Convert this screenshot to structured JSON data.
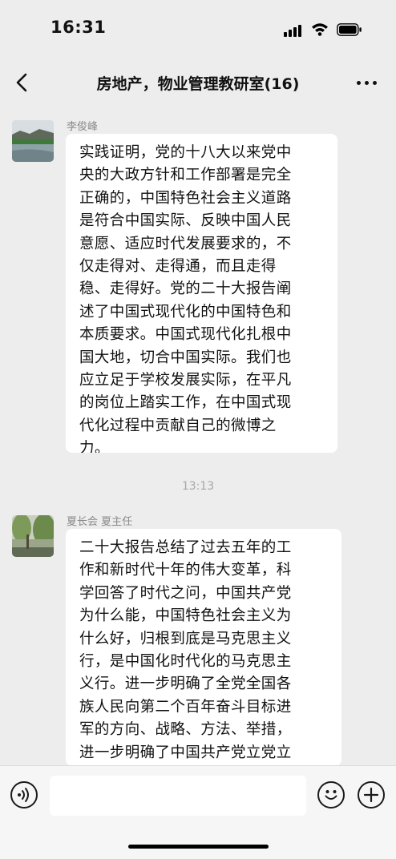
{
  "status_bar": {
    "time": "16:31",
    "icons": [
      "signal-icon",
      "wifi-icon",
      "battery-icon"
    ]
  },
  "nav": {
    "title": "房地产，物业管理教研室(16)",
    "back_icon": "chevron-left-icon",
    "more_icon": "more-dots-icon"
  },
  "messages": [
    {
      "sender": "李俊峰",
      "text": "实践证明，党的十八大以来党中\n央的大政方针和工作部署是完全\n正确的，中国特色社会主义道路\n是符合中国实际、反映中国人民\n意愿、适应时代发展要求的，不\n仅走得对、走得通，而且走得\n稳、走得好。党的二十大报告阐\n述了中国式现代化的中国特色和\n本质要求。中国式现代化扎根中\n国大地，切合中国实际。我们也\n应立足于学校发展实际，在平凡\n的岗位上踏实工作，在中国式现\n代化过程中贡献自己的微博之\n力。"
    },
    {
      "time_divider": "13:13"
    },
    {
      "sender": "夏长会 夏主任",
      "text": "二十大报告总结了过去五年的工\n作和新时代十年的伟大变革，科\n学回答了时代之问，中国共产党\n为什么能，中国特色社会主义为\n什么好，归根到底是马克思主义\n行，是中国化时代化的马克思主\n义行。进一步明确了全党全国各\n族人民向第二个百年奋斗目标进\n军的方向、战略、方法、举措，\n进一步明确了中国共产党立党立\n国、兴党兴国的根本，开辟马克"
    }
  ],
  "input_bar": {
    "voice_icon": "voice-icon",
    "input_value": "",
    "emoji_icon": "emoji-icon",
    "plus_icon": "plus-icon"
  },
  "colors": {
    "background": "#ededed",
    "bubble": "#ffffff",
    "secondary_text": "#8a8a8a"
  }
}
